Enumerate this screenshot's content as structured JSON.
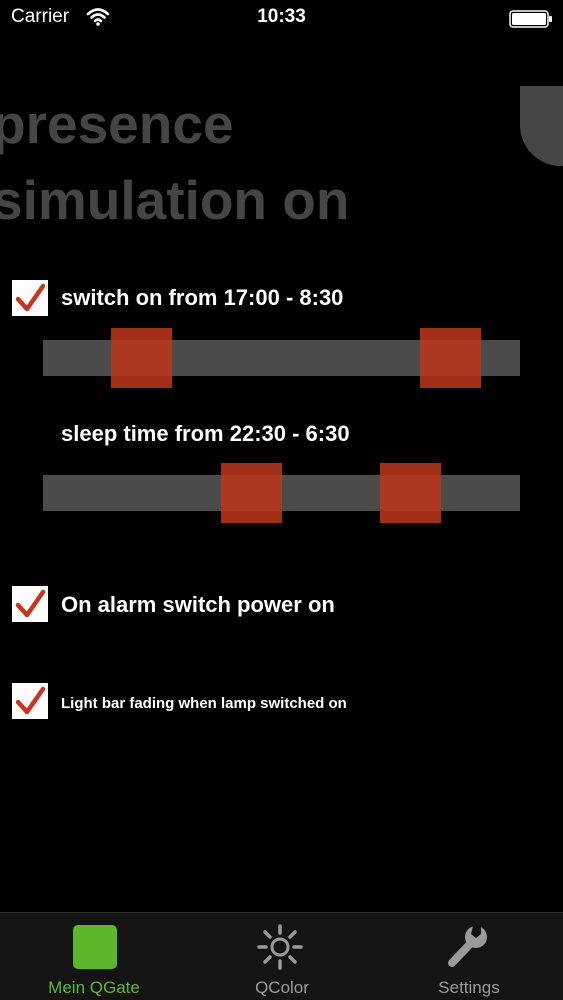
{
  "status_bar": {
    "carrier": "Carrier",
    "time": "10:33",
    "wifi_icon": "wifi-icon",
    "battery_icon": "battery-icon"
  },
  "header": {
    "title_line1": "presence",
    "title_line2": "simulation on"
  },
  "options": {
    "switch_on": {
      "checked": true,
      "label": "switch on from 17:00 - 8:30"
    },
    "sleep_time": {
      "label": "sleep time from 22:30 - 6:30"
    },
    "alarm_power": {
      "checked": true,
      "label": "On alarm switch power on"
    },
    "light_fading": {
      "checked": true,
      "label": "Light bar fading when lamp switched on"
    }
  },
  "tabs": [
    {
      "label": "Mein QGate",
      "icon": "green-square-icon",
      "active": true
    },
    {
      "label": "QColor",
      "icon": "sun-icon",
      "active": false
    },
    {
      "label": "Settings",
      "icon": "wrench-icon",
      "active": false
    }
  ],
  "colors": {
    "background": "#000000",
    "headline": "#454545",
    "track": "#4b4b4b",
    "handle": "#be3719",
    "checkmark": "#c8341e",
    "tab_active": "#5cb82a",
    "tab_inactive": "#9a9a9a"
  }
}
